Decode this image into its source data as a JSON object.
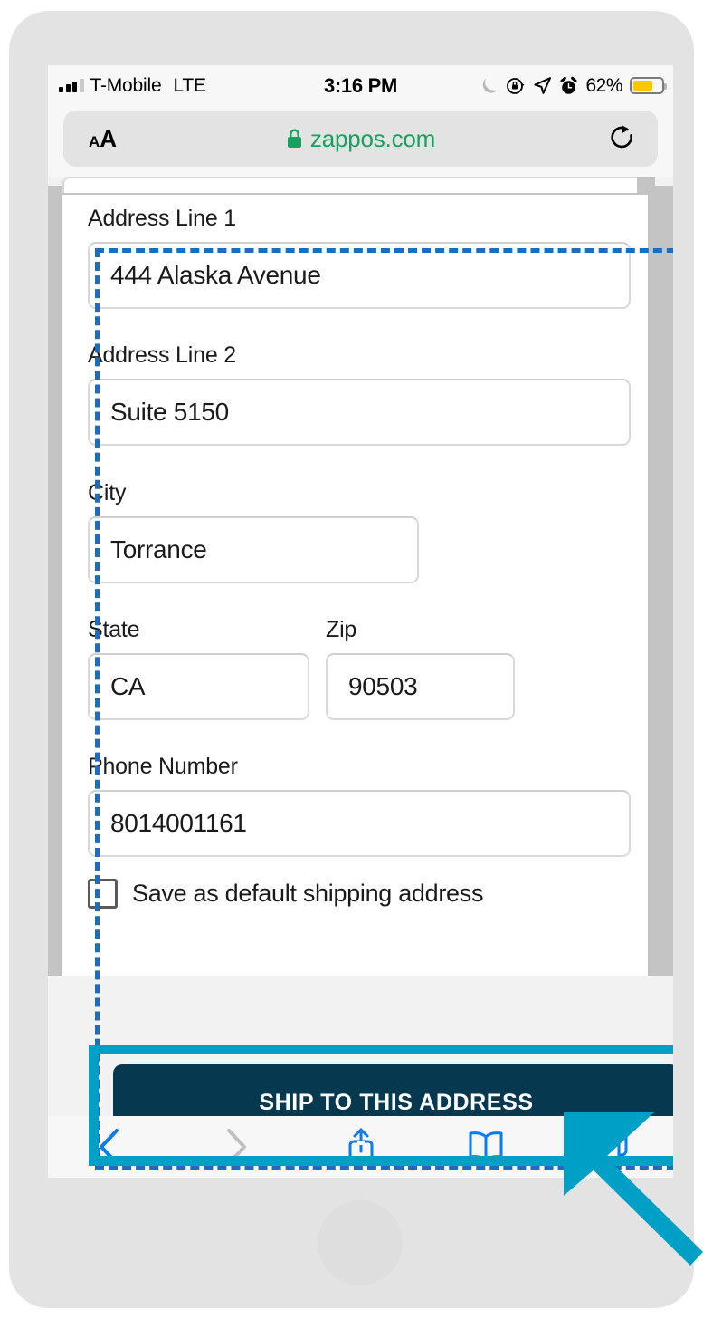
{
  "status_bar": {
    "signal_icon": "signal-bars-icon",
    "carrier": "T-Mobile",
    "network": "LTE",
    "time": "3:16 PM",
    "do_not_disturb_icon": "moon-icon",
    "orientation_lock_icon": "rotation-lock-icon",
    "location_icon": "location-arrow-icon",
    "alarm_icon": "alarm-clock-icon",
    "battery_percent": "62%",
    "battery_icon": "battery-icon"
  },
  "browser": {
    "text_size_small": "A",
    "text_size_large": "A",
    "lock_icon": "lock-icon",
    "url": "zappos.com",
    "reload_icon": "reload-icon",
    "secure_color": "#17a05e"
  },
  "form": {
    "fields": [
      {
        "label": "Address Line 1",
        "value": "444 Alaska Avenue"
      },
      {
        "label": "Address Line 2",
        "value": "Suite 5150"
      },
      {
        "label": "City",
        "value": "Torrance"
      },
      {
        "label": "State",
        "value": "CA"
      },
      {
        "label": "Zip",
        "value": "90503"
      },
      {
        "label": "Phone Number",
        "value": "8014001161"
      }
    ],
    "checkbox": {
      "label": "Save as default shipping address",
      "checked": false
    }
  },
  "primary_action": {
    "label": "SHIP TO THIS ADDRESS",
    "background": "#06394f",
    "text_color": "#ffffff"
  },
  "toolbar": {
    "back_icon": "chevron-left-icon",
    "forward_icon": "chevron-right-icon",
    "share_icon": "share-icon",
    "bookmarks_icon": "book-icon",
    "tabs_icon": "tabs-icon",
    "active_color": "#0a7cf0",
    "disabled_color": "#c0c0c0"
  },
  "annotations": {
    "region_outline_color": "#1b6dc0",
    "highlight_color": "#00a0c6",
    "cursor_icon": "arrow-cursor-icon"
  }
}
